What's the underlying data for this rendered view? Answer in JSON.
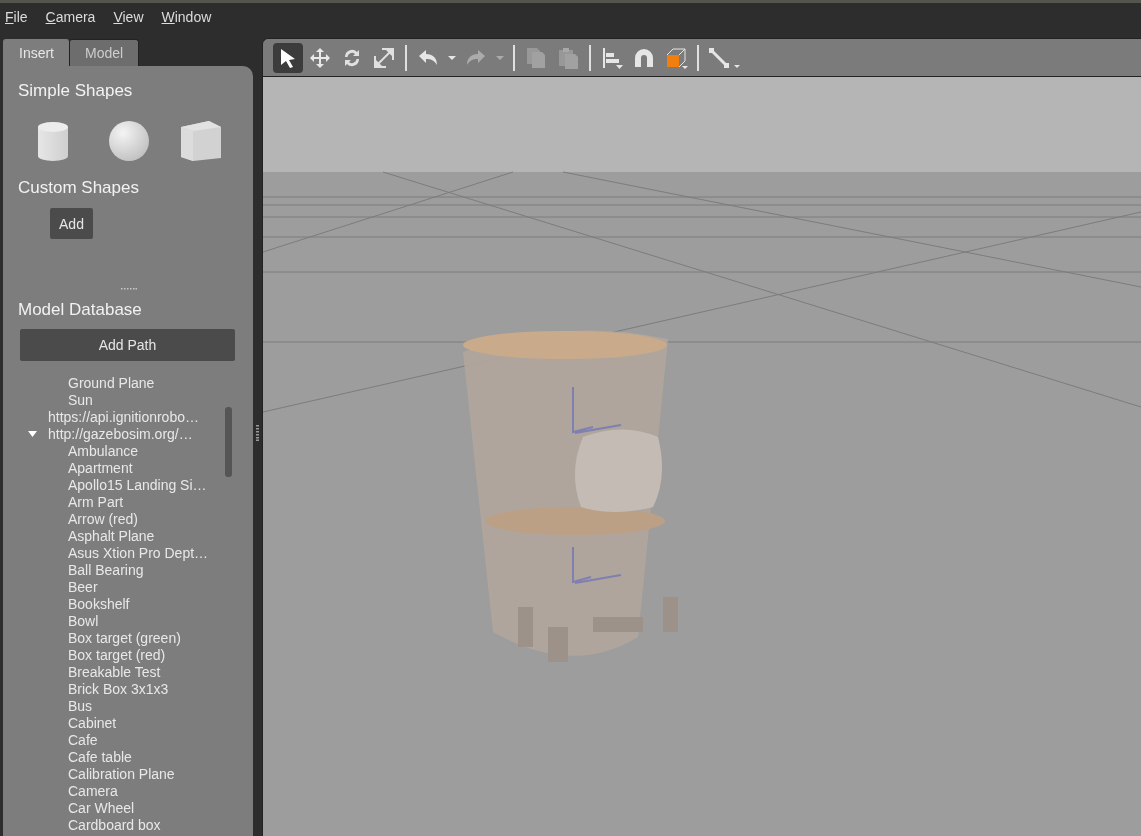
{
  "menu_bar": {
    "items": [
      "File",
      "Camera",
      "View",
      "Window"
    ]
  },
  "panel_tabs": [
    {
      "label": "Insert",
      "selected": true
    },
    {
      "label": "Model",
      "selected": false
    }
  ],
  "simple_shapes": {
    "title": "Simple Shapes",
    "shapes": [
      {
        "kind": "cylinder"
      },
      {
        "kind": "sphere"
      },
      {
        "kind": "box"
      }
    ]
  },
  "custom_shapes": {
    "title": "Custom Shapes",
    "button": "Add"
  },
  "model_database": {
    "title": "Model Database",
    "button": "Add Path",
    "tree": {
      "continued_items": [
        {
          "label": "Ground Plane"
        },
        {
          "label": "Sun"
        }
      ],
      "nodes": [
        {
          "label": "https://api.ignitionrobo…"
        },
        {
          "label": "http://gazebosim.org/…",
          "expanded": true,
          "children": [
            {
              "label": "Ambulance"
            },
            {
              "label": "Apartment"
            },
            {
              "label": "Apollo15 Landing Si…"
            },
            {
              "label": "Arm Part"
            },
            {
              "label": "Arrow (red)"
            },
            {
              "label": "Asphalt Plane"
            },
            {
              "label": "Asus Xtion Pro Dept…"
            },
            {
              "label": "Ball Bearing"
            },
            {
              "label": "Beer"
            },
            {
              "label": "Bookshelf"
            },
            {
              "label": "Bowl"
            },
            {
              "label": "Box target (green)"
            },
            {
              "label": "Box target (red)"
            },
            {
              "label": "Breakable Test"
            },
            {
              "label": "Brick Box 3x1x3"
            },
            {
              "label": "Bus"
            },
            {
              "label": "Cabinet"
            },
            {
              "label": "Cafe"
            },
            {
              "label": "Cafe table"
            },
            {
              "label": "Calibration Plane"
            },
            {
              "label": "Camera"
            },
            {
              "label": "Car Wheel"
            },
            {
              "label": "Cardboard box"
            }
          ]
        }
      ]
    }
  },
  "toolbar": [
    {
      "kind": "select",
      "selected": true,
      "disabled": false
    },
    {
      "kind": "translate",
      "selected": false,
      "disabled": false
    },
    {
      "kind": "rotate",
      "selected": false,
      "disabled": false
    },
    {
      "kind": "scale",
      "selected": false,
      "disabled": false
    },
    {
      "kind": "separator"
    },
    {
      "kind": "undo",
      "selected": false,
      "disabled": false
    },
    {
      "kind": "dropdown",
      "disabled": false
    },
    {
      "kind": "redo",
      "selected": false,
      "disabled": true
    },
    {
      "kind": "dropdown",
      "disabled": true
    },
    {
      "kind": "separator"
    },
    {
      "kind": "copy",
      "selected": false,
      "disabled": true
    },
    {
      "kind": "paste",
      "selected": false,
      "disabled": true
    },
    {
      "kind": "separator"
    },
    {
      "kind": "align",
      "selected": false,
      "disabled": false
    },
    {
      "kind": "snap",
      "selected": false,
      "disabled": false
    },
    {
      "kind": "view",
      "selected": false,
      "disabled": false
    },
    {
      "kind": "separator"
    },
    {
      "kind": "joint",
      "selected": false,
      "disabled": false
    }
  ]
}
